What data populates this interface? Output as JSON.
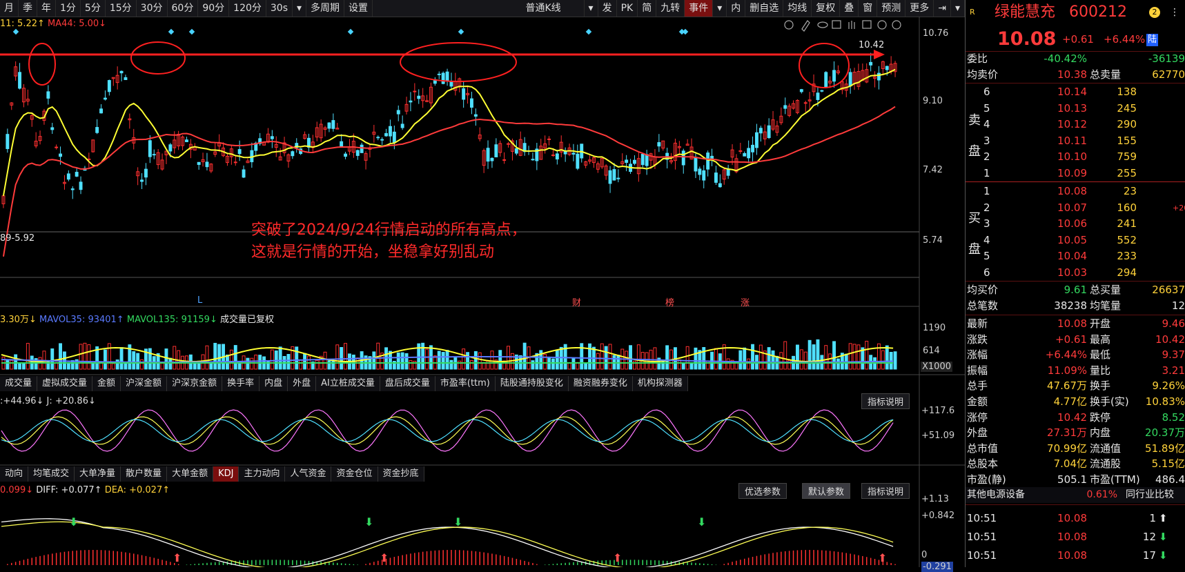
{
  "toolbar": {
    "periods": [
      "月",
      "季",
      "年",
      "1分",
      "5分",
      "15分",
      "30分",
      "60分",
      "90分",
      "120分",
      "30s",
      "▾",
      "多周期",
      "设置"
    ],
    "chart_type": "普通K线",
    "tools": [
      "▾",
      "发",
      "PK",
      "简",
      "九转",
      "事件",
      "▾",
      "内",
      "删自选",
      "均线",
      "复权",
      "叠",
      "窗",
      "预测",
      "更多"
    ]
  },
  "main_chart": {
    "legend_ma11": "11: 5.22↑",
    "legend_ma44": "MA44: 5.00↓",
    "left_label": "89-5.92",
    "high_label": "10.42",
    "price_axis": [
      "10.76",
      "9.10",
      "7.42",
      "5.74"
    ],
    "annotation_line1": "突破了2024/9/24行情启动的所有高点，",
    "annotation_line2": "这就是行情的开始，坐稳拿好别乱动",
    "markers": [
      "L",
      "财",
      "榜",
      "涨"
    ],
    "colors": {
      "up": "#ff3030",
      "down": "#4fe0ff",
      "ma_short": "#ffff33",
      "ma_long": "#ff3b3b",
      "arrow": "#ff2020"
    }
  },
  "volume": {
    "legend_a": "3.30万↓",
    "legend_b": "MAVOL35: 93401↑",
    "legend_c": "MAVOL135: 91159↓",
    "legend_d": "成交量已复权",
    "axis": [
      "1190",
      "614",
      "X1000"
    ]
  },
  "tabs1": [
    "成交量",
    "虚拟成交量",
    "金额",
    "沪深金额",
    "沪深京金额",
    "换手率",
    "内盘",
    "外盘",
    "AI立桩成交量",
    "盘后成交量",
    "市盈率(ttm)",
    "陆股通持股变化",
    "融资融券变化",
    "机构探测器"
  ],
  "kdj": {
    "legend": ":+44.96↓  J: +20.86↓",
    "explain_btn": "指标说明",
    "axis": [
      "+117.6",
      "+51.09"
    ]
  },
  "tabs2": [
    "动向",
    "均笔成交",
    "大单净量",
    "散户数量",
    "大单金额",
    "KDJ",
    "主力动向",
    "人气资金",
    "资金仓位",
    "资金抄底"
  ],
  "macd": {
    "legend_a": "0.099↓",
    "legend_b": "DIFF: +0.077↑",
    "legend_c": "DEA: +0.027↑",
    "btn_opt": "优选参数",
    "btn_default": "默认参数",
    "btn_explain": "指标说明",
    "axis": [
      "+1.13",
      "+0.842",
      "0",
      "-0.291"
    ]
  },
  "panel": {
    "r": "R",
    "name": "绿能慧充",
    "code": "600212",
    "badge": "2",
    "price": "10.08",
    "change": "+0.61",
    "pct": "+6.44%",
    "market": "陆",
    "weibi_label": "委比",
    "weibi_value": "-40.42%",
    "weibi_diff": "-36139",
    "avg_sell_label": "均卖价",
    "avg_sell": "10.38",
    "total_sell_label": "总卖量",
    "total_sell": "62770",
    "sell_side_label": [
      "卖",
      "盘"
    ],
    "sells": [
      {
        "lvl": "6",
        "price": "10.14",
        "vol": "138"
      },
      {
        "lvl": "5",
        "price": "10.13",
        "vol": "245"
      },
      {
        "lvl": "4",
        "price": "10.12",
        "vol": "290"
      },
      {
        "lvl": "3",
        "price": "10.11",
        "vol": "155"
      },
      {
        "lvl": "2",
        "price": "10.10",
        "vol": "759"
      },
      {
        "lvl": "1",
        "price": "10.09",
        "vol": "255"
      }
    ],
    "buy_side_label": [
      "买",
      "盘"
    ],
    "buys": [
      {
        "lvl": "1",
        "price": "10.08",
        "vol": "23",
        "extra": ""
      },
      {
        "lvl": "2",
        "price": "10.07",
        "vol": "160",
        "extra": "+20"
      },
      {
        "lvl": "3",
        "price": "10.06",
        "vol": "241",
        "extra": ""
      },
      {
        "lvl": "4",
        "price": "10.05",
        "vol": "552",
        "extra": ""
      },
      {
        "lvl": "5",
        "price": "10.04",
        "vol": "233",
        "extra": ""
      },
      {
        "lvl": "6",
        "price": "10.03",
        "vol": "294",
        "extra": ""
      }
    ],
    "avg_buy_label": "均买价",
    "avg_buy": "9.61",
    "total_buy_label": "总买量",
    "total_buy": "26637",
    "total_trades_label": "总笔数",
    "total_trades": "38238",
    "avg_trade_label": "均笔量",
    "avg_trade": "12",
    "stats": [
      {
        "l1": "最新",
        "v1": "10.08",
        "c1": "red",
        "l2": "开盘",
        "v2": "9.46",
        "c2": "red"
      },
      {
        "l1": "涨跌",
        "v1": "+0.61",
        "c1": "red",
        "l2": "最高",
        "v2": "10.42",
        "c2": "red"
      },
      {
        "l1": "涨幅",
        "v1": "+6.44%",
        "c1": "red",
        "l2": "最低",
        "v2": "9.37",
        "c2": "red"
      },
      {
        "l1": "振幅",
        "v1": "11.09%",
        "c1": "red",
        "l2": "量比",
        "v2": "3.21",
        "c2": "red"
      },
      {
        "l1": "总手",
        "v1": "47.67万",
        "c1": "yel",
        "l2": "换手",
        "v2": "9.26%",
        "c2": "yel"
      },
      {
        "l1": "金额",
        "v1": "4.77亿",
        "c1": "yel",
        "l2": "换手(实)",
        "v2": "10.83%",
        "c2": "yel"
      },
      {
        "l1": "涨停",
        "v1": "10.42",
        "c1": "red",
        "l2": "跌停",
        "v2": "8.52",
        "c2": "green"
      },
      {
        "l1": "外盘",
        "v1": "27.31万",
        "c1": "red",
        "l2": "内盘",
        "v2": "20.37万",
        "c2": "green"
      },
      {
        "l1": "总市值",
        "v1": "70.99亿",
        "c1": "yel",
        "l2": "流通值",
        "v2": "51.89亿",
        "c2": "yel"
      },
      {
        "l1": "总股本",
        "v1": "7.04亿",
        "c1": "yel",
        "l2": "流通股",
        "v2": "5.15亿",
        "c2": "yel"
      },
      {
        "l1": "市盈(静)",
        "v1": "505.1",
        "c1": "white",
        "l2": "市盈(TTM)",
        "v2": "486.4",
        "c2": "white"
      }
    ],
    "sector_name": "其他电源设备",
    "sector_pct": "0.61%",
    "sector_btn": "同行业比较",
    "ticks": [
      {
        "time": "10:51",
        "price": "10.08",
        "vol": "1",
        "dir": "up"
      },
      {
        "time": "10:51",
        "price": "10.08",
        "vol": "12",
        "dir": "down"
      },
      {
        "time": "10:51",
        "price": "10.08",
        "vol": "17",
        "dir": "down"
      }
    ]
  }
}
